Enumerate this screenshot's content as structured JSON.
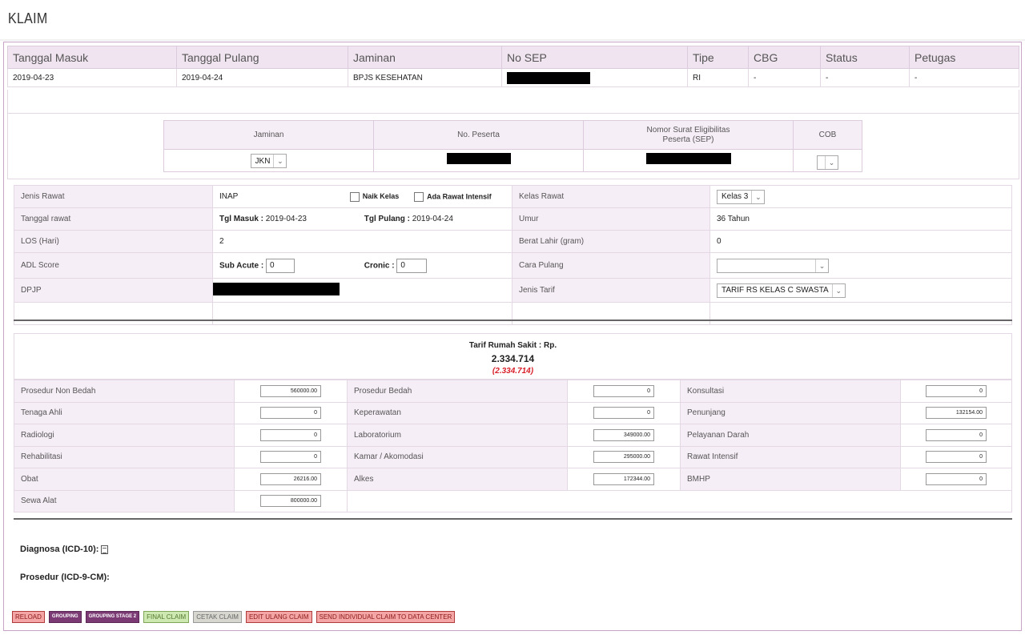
{
  "page": {
    "title": "KLAIM"
  },
  "claim": {
    "headers": [
      "Tanggal Masuk",
      "Tanggal Pulang",
      "Jaminan",
      "No SEP",
      "Tipe",
      "CBG",
      "Status",
      "Petugas"
    ],
    "row": [
      "2019-04-23",
      "2019-04-24",
      "BPJS KESEHATAN",
      "",
      "RI",
      "-",
      "-",
      "-"
    ]
  },
  "jaminan": {
    "headers": [
      "Jaminan",
      "No. Peserta",
      "Nomor Surat Eligibilitas Peserta (SEP)",
      "COB"
    ],
    "jaminan_value": "JKN",
    "cob_value": ""
  },
  "detail": {
    "jenis_rawat_label": "Jenis Rawat",
    "jenis_rawat": "INAP",
    "naik_kelas": "Naik Kelas",
    "rawat_intensif": "Ada Rawat Intensif",
    "kelas_rawat_label": "Kelas Rawat",
    "kelas_rawat": "Kelas 3",
    "tanggal_rawat_label": "Tanggal rawat",
    "tgl_masuk_label": "Tgl Masuk :",
    "tgl_masuk": "2019-04-23",
    "tgl_pulang_label": "Tgl Pulang :",
    "tgl_pulang": "2019-04-24",
    "umur_label": "Umur",
    "umur": "36 Tahun",
    "los_label": "LOS (Hari)",
    "los": "2",
    "berat_label": "Berat Lahir (gram)",
    "berat": "0",
    "adl_label": "ADL Score",
    "sub_acute_label": "Sub Acute :",
    "sub_acute": "0",
    "cronic_label": "Cronic :",
    "cronic": "0",
    "cara_pulang_label": "Cara Pulang",
    "cara_pulang": "",
    "dpjp_label": "DPJP",
    "jenis_tarif_label": "Jenis Tarif",
    "jenis_tarif": "TARIF RS KELAS C SWASTA"
  },
  "tarif": {
    "title": "Tarif Rumah Sakit : Rp.",
    "total": "2.334.714",
    "total_paren": "(2.334.714)",
    "rows": [
      [
        "Prosedur Non Bedah",
        "560000.00",
        "Prosedur Bedah",
        "0",
        "Konsultasi",
        "0"
      ],
      [
        "Tenaga Ahli",
        "0",
        "Keperawatan",
        "0",
        "Penunjang",
        "132154.00"
      ],
      [
        "Radiologi",
        "0",
        "Laboratorium",
        "349000.00",
        "Pelayanan Darah",
        "0"
      ],
      [
        "Rehabilitasi",
        "0",
        "Kamar / Akomodasi",
        "295000.00",
        "Rawat Intensif",
        "0"
      ],
      [
        "Obat",
        "26216.00",
        "Alkes",
        "172344.00",
        "BMHP",
        "0"
      ],
      [
        "Sewa Alat",
        "800000.00"
      ]
    ]
  },
  "diagnosa": {
    "icd10_label": "Diagnosa (ICD-10):",
    "icd9_label": "Prosedur (ICD-9-CM):"
  },
  "buttons": {
    "reload": "RELOAD",
    "grouping": "GROUPING",
    "grouping2": "GROUPING STAGE 2",
    "final": "FINAL CLAIM",
    "cetak": "CETAK CLAIM",
    "edit": "EDIT ULANG CLAIM",
    "send": "SEND INDIVIDUAL CLAIM TO DATA CENTER"
  }
}
